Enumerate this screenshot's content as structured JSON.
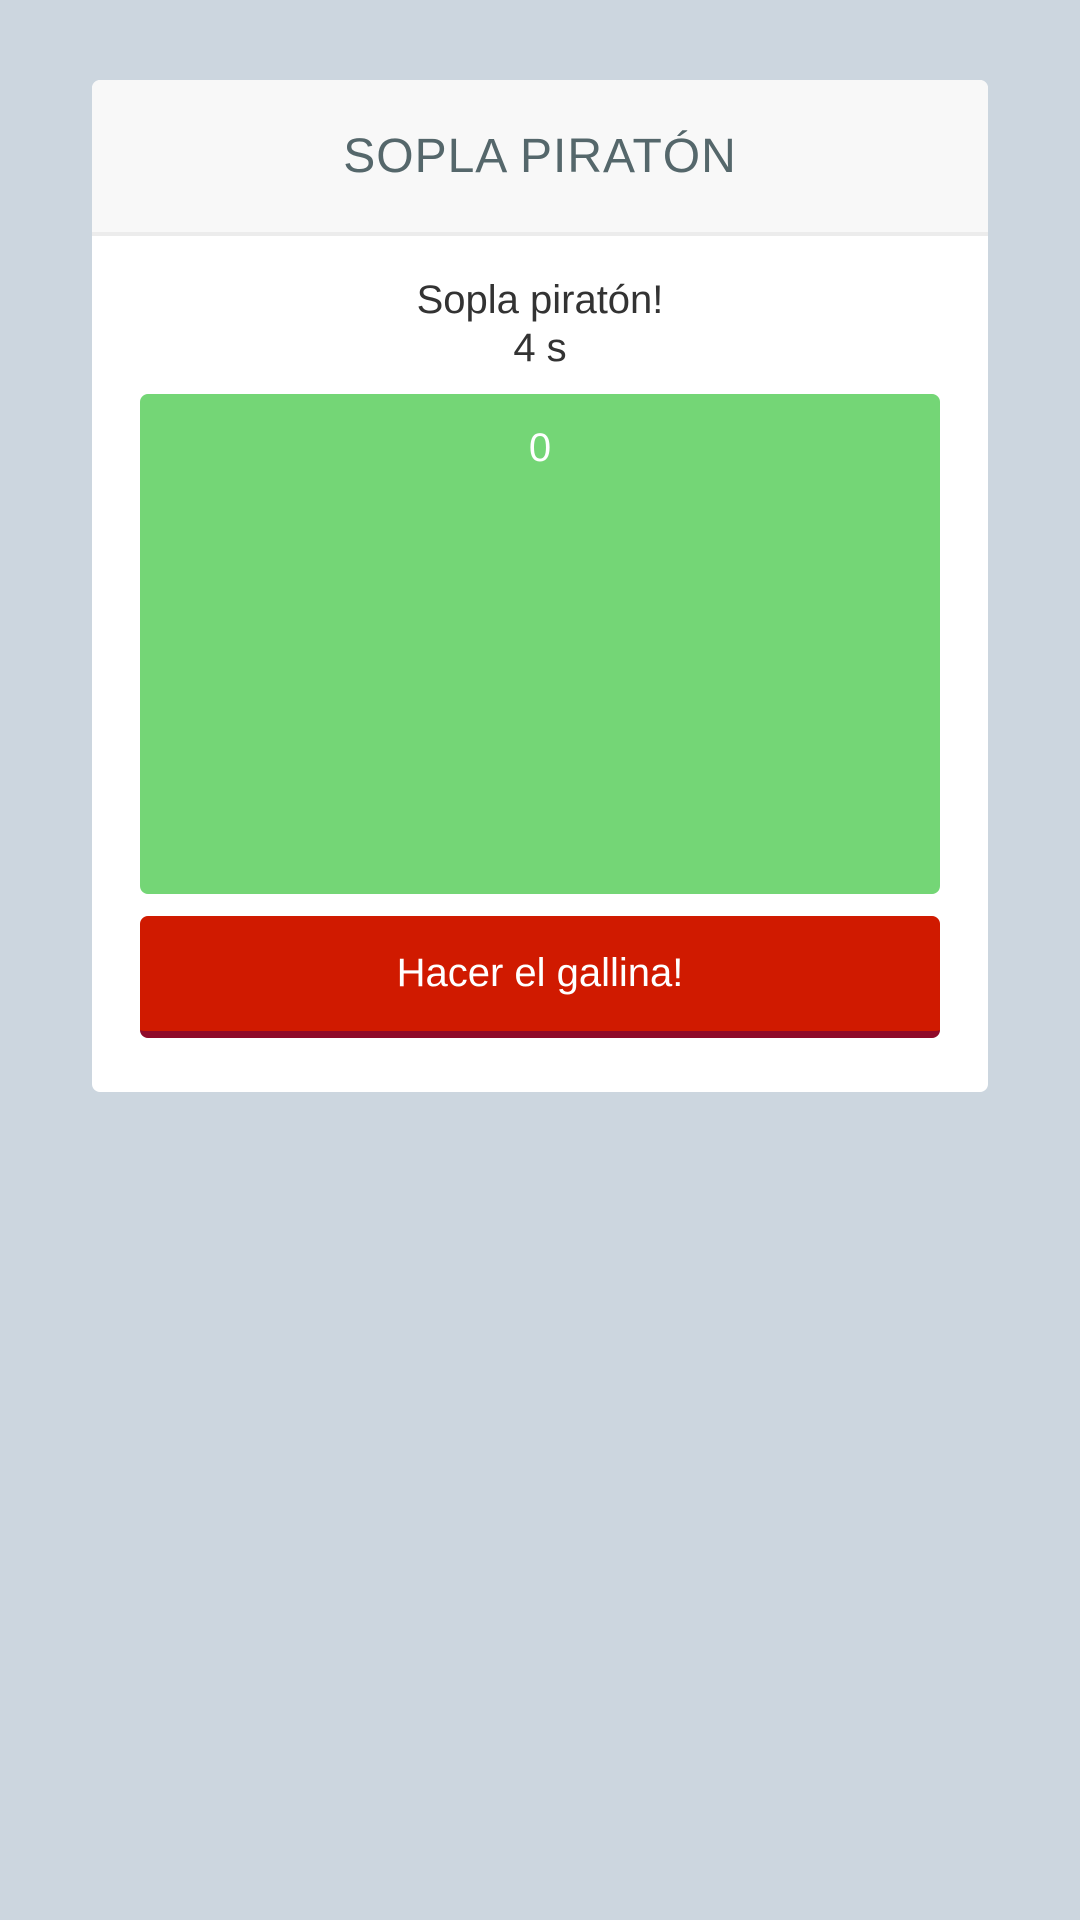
{
  "header": {
    "title": "SOPLA PIRATÓN"
  },
  "game": {
    "prompt": "Sopla piratón!",
    "timer": "4 s",
    "blow_count": "0",
    "chicken_button_label": "Hacer el gallina!"
  },
  "colors": {
    "background": "#ccd6df",
    "blow_area": "#74d676",
    "chicken_button": "#d01a00",
    "chicken_button_shadow": "#8f0a2a",
    "title": "#55676b"
  }
}
